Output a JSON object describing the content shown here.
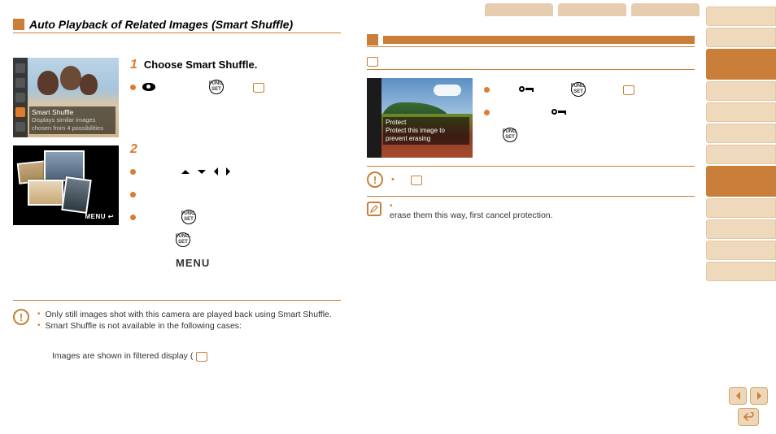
{
  "left": {
    "heading": "Auto Playback of Related Images (Smart Shuffle)",
    "screenshot1": {
      "menu_item": "Smart Shuffle",
      "description": "Displays similar images chosen from 4 possibilities"
    },
    "screenshot2": {
      "menu_badge": "MENU ↩"
    },
    "step1_num": "1",
    "step1_title": "Choose Smart Shuffle.",
    "step2_num": "2",
    "menu_label": "MENU",
    "func_label_top": "FUNC.",
    "func_label_bot": "SET",
    "note1": "Only still images shot with this camera are played back using Smart Shuffle.",
    "note2": "Smart Shuffle is not available in the following cases:",
    "footer": "Images are shown in filtered display ("
  },
  "right": {
    "screenshot": {
      "title": "Protect",
      "description": "Protect this image to prevent erasing"
    },
    "pencil_note": "erase them this way, first cancel protection.",
    "warn_bullet": "•",
    "pencil_bullet": "•"
  },
  "icons": {
    "func_top": "FUNC.",
    "func_bot": "SET"
  }
}
